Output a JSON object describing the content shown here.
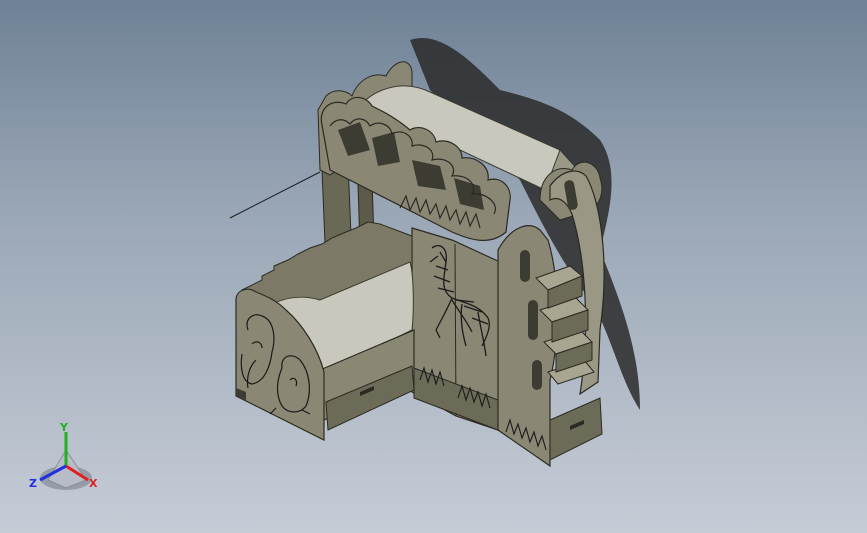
{
  "app": {
    "view": "isometric-3d-viewport"
  },
  "model": {
    "description_icon": "bunk-bed-model"
  },
  "triad": {
    "x_label": "X",
    "y_label": "Y",
    "z_label": "Z",
    "colors": {
      "x": "#e02020",
      "y": "#20b020",
      "z": "#2030e0"
    }
  },
  "colors": {
    "background_top": "#6f8196",
    "background_bottom": "#c6ccd6",
    "model_fill": "#7c7a66",
    "model_light": "#a8a690",
    "model_dark": "#4a4a3c",
    "mattress": "#c9c8bc",
    "shadow": "#2a2a2a"
  }
}
